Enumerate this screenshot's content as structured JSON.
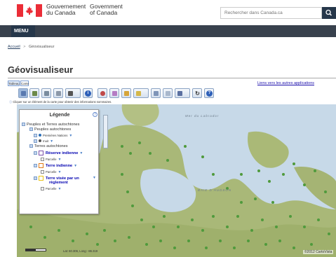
{
  "header": {
    "gov_en_line1": "Gouvernement",
    "gov_en_line2": "du Canada",
    "gov_fr_line1": "Government",
    "gov_fr_line2": "of Canada",
    "search_placeholder": "Rechercher dans Canada.ca",
    "search_icon": "search-icon",
    "flag_color": "#eb2d37"
  },
  "menu": {
    "label": "MENU"
  },
  "breadcrumb": {
    "home": "Accueil",
    "current": "Géovisualiseur",
    "separator": ">"
  },
  "page": {
    "title": "Géovisualiseur"
  },
  "app": {
    "tabs": [
      "Tableau",
      "Carte"
    ],
    "apps_link": "Liens vers les autres applications",
    "info_line": "Cliquer sur un élément de la carte pour obtenir des informations sommaires.",
    "toolbar_icons": [
      "select-icon",
      "table-icon",
      "layers-icon",
      "grid-icon",
      "print-icon",
      "identify-icon",
      "zoom-icon",
      "draw-icon",
      "filter-icon",
      "tools-icon",
      "export-icon",
      "email-icon",
      "save-icon",
      "refresh-icon",
      "help-icon"
    ]
  },
  "legend": {
    "title": "Légende",
    "help": "?",
    "items": [
      {
        "label": "Peuples et Terres autochtones"
      },
      {
        "label": "Peuples autochtones"
      },
      {
        "label": "Premières Nations",
        "color": "#2b6fb8"
      },
      {
        "label": "Inuit",
        "color": "#555555"
      },
      {
        "label": "Terres autochtones"
      },
      {
        "label": "Réserve indienne",
        "color": "#7b4fa8"
      },
      {
        "label": "Parcelle"
      },
      {
        "label": "Terre indienne",
        "color": "#e07b1a"
      },
      {
        "label": "Parcelle"
      },
      {
        "label": "Terre visée par un",
        "label2": "règlement",
        "color": "#e8c21a"
      },
      {
        "label": "Parcelle"
      }
    ]
  },
  "map": {
    "labels": [
      "Mer du Labrador",
      "BAIE D'HUDSON"
    ],
    "coords": "Lat: 60.306, Long: -86.319",
    "copyright": "©2012 CartoVista"
  }
}
